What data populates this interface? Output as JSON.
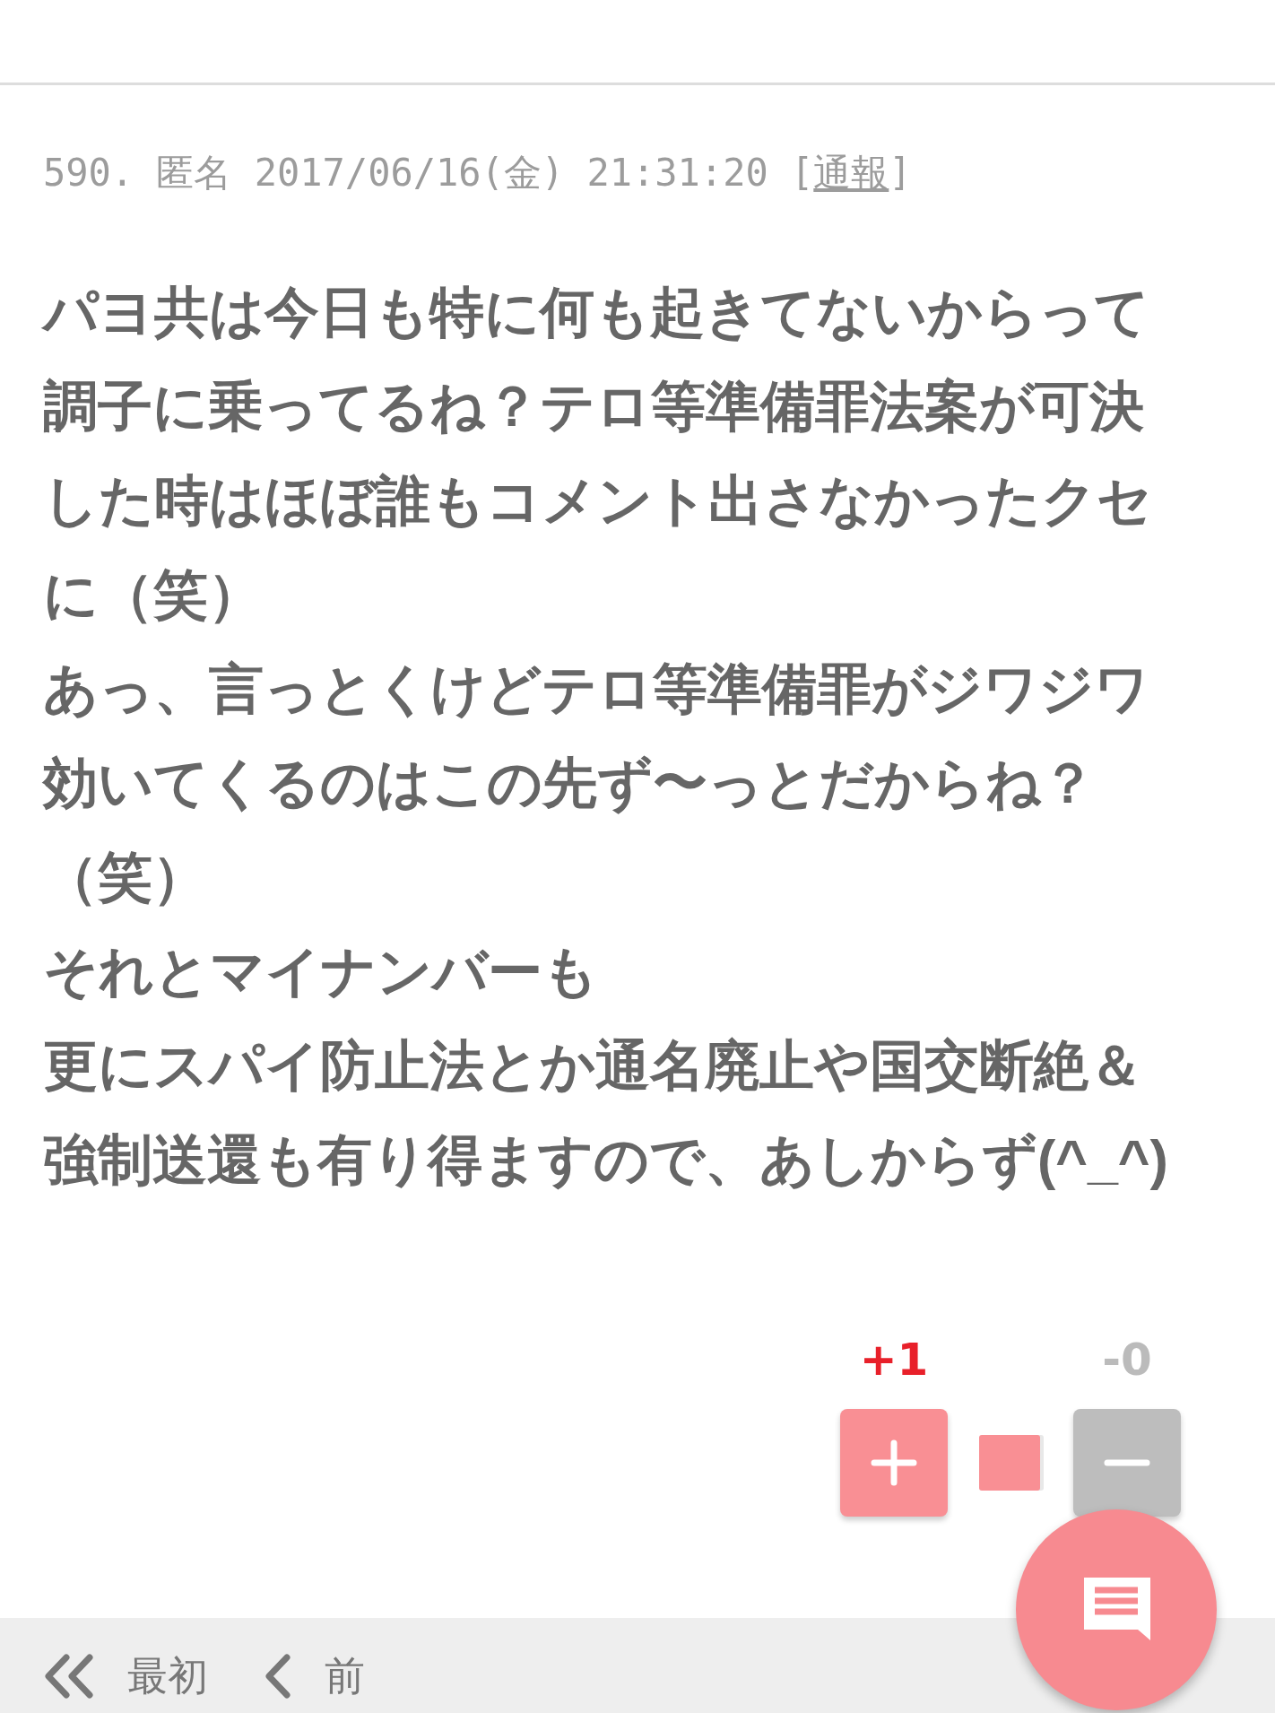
{
  "post": {
    "meta_text": "590. 匿名 2017/06/16(金) 21:31:20 [",
    "report_link": "通報",
    "meta_end": "]",
    "body": [
      "パヨ共は今日も特に何も起きてないからって調子に乗ってるね？テロ等準備罪法案が可決した時はほぼ誰もコメント出さなかったクセに（笑）",
      "あっ、言っとくけどテロ等準備罪がジワジワ効いてくるのはこの先ず〜っとだからね？（笑）",
      "それとマイナンバーも",
      "更にスパイ防止法とか通名廃止や国交断絶＆",
      "強制送還も有り得ますので、あしからず(^_^)"
    ]
  },
  "votes": {
    "plus_count": "+1",
    "minus_count": "-0"
  },
  "nav": [
    {
      "kind": "first",
      "label": "最初"
    },
    {
      "kind": "prev",
      "label": "前"
    }
  ]
}
